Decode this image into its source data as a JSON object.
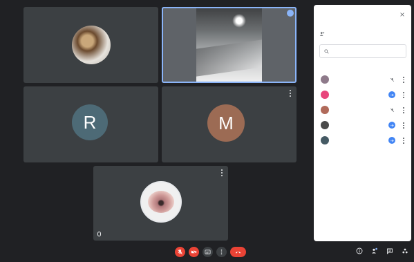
{
  "tiles": [
    {
      "id": "t1",
      "name": "",
      "avatar_type": "photo-circle",
      "active": false
    },
    {
      "id": "t2",
      "name": "",
      "avatar_type": "camera-feed",
      "active": true
    },
    {
      "id": "t3",
      "name": "",
      "initial": "R",
      "avatar_color": "#4d6a76",
      "active": false
    },
    {
      "id": "t4",
      "name": "",
      "initial": "M",
      "avatar_color": "#9c6b54",
      "active": false
    },
    {
      "id": "t5",
      "name": "",
      "avatar_type": "photo-circle",
      "active": false
    }
  ],
  "meeting": {
    "info": "",
    "presenter_note": ""
  },
  "controls": [
    {
      "name": "mic-toggle",
      "icon": "mic-off-icon",
      "color": "#ea4335"
    },
    {
      "name": "camera-toggle",
      "icon": "camera-off-icon",
      "color": "#ea4335"
    },
    {
      "name": "captions-toggle",
      "icon": "captions-icon",
      "color": "#3c4043"
    },
    {
      "name": "more-options",
      "icon": "more-vert-icon",
      "color": "#3c4043"
    },
    {
      "name": "leave-call",
      "icon": "call-end-icon",
      "color": "#ea4335"
    }
  ],
  "right_icons": [
    "info-icon",
    "people-icon",
    "chat-icon",
    "activities-icon"
  ],
  "panel": {
    "title": "",
    "add_people": "",
    "search_placeholder": "",
    "section_label": "",
    "people": [
      {
        "name": "",
        "avatar_color": "#8e7a8a",
        "status": "mic-off"
      },
      {
        "name": "",
        "avatar_color": "#e8467c",
        "status": "speaking"
      },
      {
        "name": "",
        "avatar_color": "#b06a5a",
        "status": "mic-off"
      },
      {
        "name": "",
        "avatar_color": "#4a4a4a",
        "status": "speaking"
      },
      {
        "name": "",
        "avatar_color": "#455a64",
        "status": "speaking"
      }
    ]
  },
  "colors": {
    "background": "#202124",
    "tile": "#3c4043",
    "accent": "#8ab4f8",
    "danger": "#ea4335",
    "speaking": "#4285f4"
  }
}
